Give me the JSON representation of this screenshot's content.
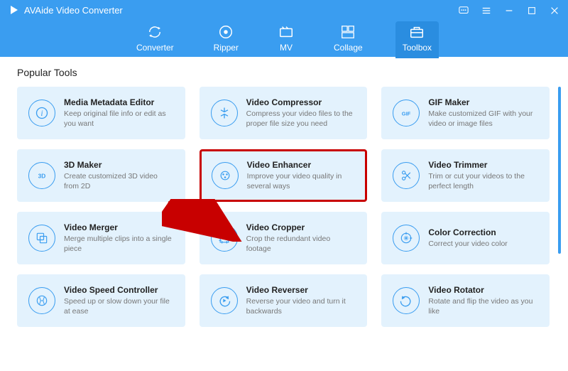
{
  "app": {
    "title": "AVAide Video Converter"
  },
  "tabs": {
    "converter": "Converter",
    "ripper": "Ripper",
    "mv": "MV",
    "collage": "Collage",
    "toolbox": "Toolbox"
  },
  "section": {
    "title": "Popular Tools"
  },
  "tools": [
    {
      "title": "Media Metadata Editor",
      "desc": "Keep original file info or edit as you want"
    },
    {
      "title": "Video Compressor",
      "desc": "Compress your video files to the proper file size you need"
    },
    {
      "title": "GIF Maker",
      "desc": "Make customized GIF with your video or image files"
    },
    {
      "title": "3D Maker",
      "desc": "Create customized 3D video from 2D"
    },
    {
      "title": "Video Enhancer",
      "desc": "Improve your video quality in several ways"
    },
    {
      "title": "Video Trimmer",
      "desc": "Trim or cut your videos to the perfect length"
    },
    {
      "title": "Video Merger",
      "desc": "Merge multiple clips into a single piece"
    },
    {
      "title": "Video Cropper",
      "desc": "Crop the redundant video footage"
    },
    {
      "title": "Color Correction",
      "desc": "Correct your video color"
    },
    {
      "title": "Video Speed Controller",
      "desc": "Speed up or slow down your file at ease"
    },
    {
      "title": "Video Reverser",
      "desc": "Reverse your video and turn it backwards"
    },
    {
      "title": "Video Rotator",
      "desc": "Rotate and flip the video as you like"
    }
  ],
  "highlightedIndex": 4,
  "colors": {
    "accent": "#3a9df0",
    "highlight": "#c80000",
    "card": "#e3f2fd"
  }
}
